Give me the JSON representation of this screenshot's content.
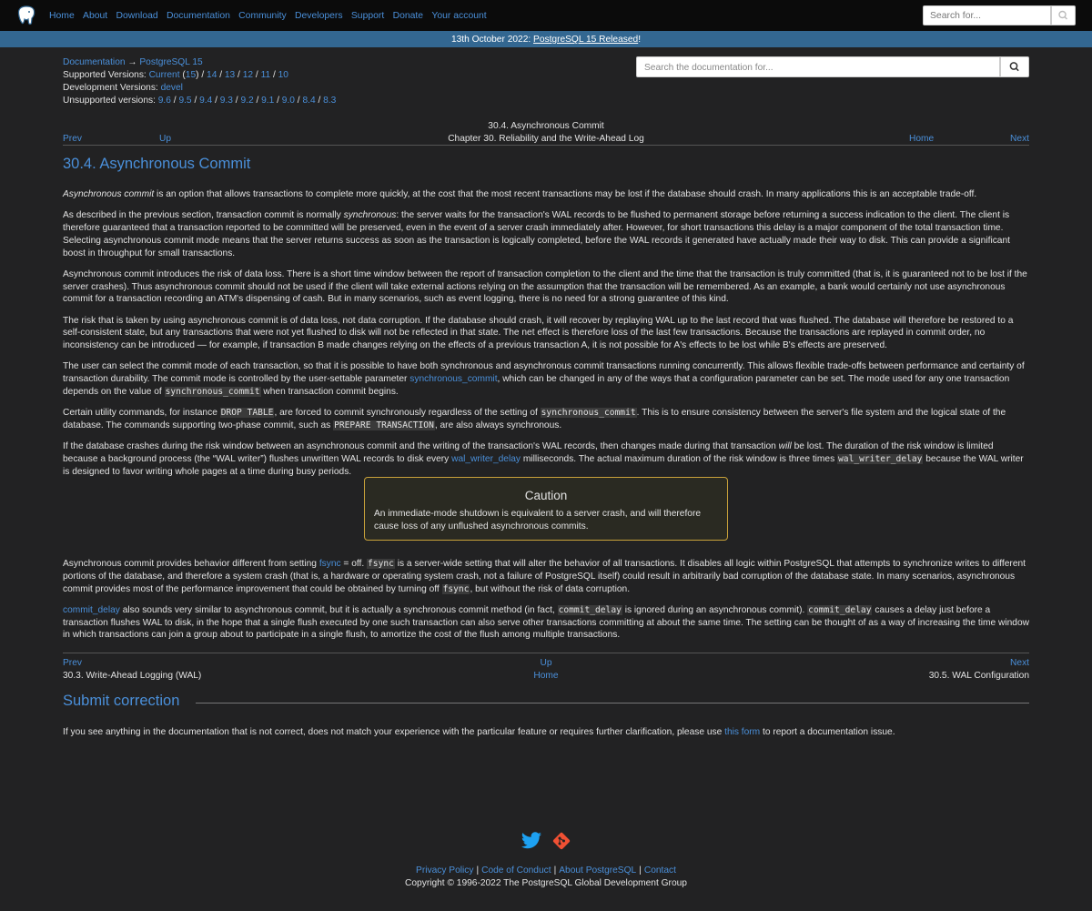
{
  "nav": {
    "items": [
      "Home",
      "About",
      "Download",
      "Documentation",
      "Community",
      "Developers",
      "Support",
      "Donate",
      "Your account"
    ],
    "search_placeholder": "Search for..."
  },
  "banner": {
    "date": "13th October 2022: ",
    "link": "PostgreSQL 15 Released",
    "end": "!"
  },
  "breadcrumb": {
    "documentation": "Documentation",
    "arrow": " → ",
    "current": "PostgreSQL 15"
  },
  "versions": {
    "supported_label": "Supported Versions: ",
    "current": "Current",
    "current_num": "15",
    "supported": [
      "14",
      "13",
      "12",
      "11",
      "10"
    ],
    "dev_label": "Development Versions: ",
    "devel": "devel",
    "unsupported_label": "Unsupported versions: ",
    "unsupported": [
      "9.6",
      "9.5",
      "9.4",
      "9.3",
      "9.2",
      "9.1",
      "9.0",
      "8.4",
      "8.3"
    ]
  },
  "doc_search_placeholder": "Search the documentation for...",
  "header": {
    "title": "30.4. Asynchronous Commit",
    "chapter": "Chapter 30. Reliability and the Write-Ahead Log",
    "prev": "Prev",
    "up": "Up",
    "home": "Home",
    "next": "Next"
  },
  "section_title": "30.4. Asynchronous Commit",
  "paragraphs": {
    "p1_em": "Asynchronous commit",
    "p1": " is an option that allows transactions to complete more quickly, at the cost that the most recent transactions may be lost if the database should crash. In many applications this is an acceptable trade-off.",
    "p2_a": "As described in the previous section, transaction commit is normally ",
    "p2_em": "synchronous",
    "p2_b": ": the server waits for the transaction's WAL records to be flushed to permanent storage before returning a success indication to the client. The client is therefore guaranteed that a transaction reported to be committed will be preserved, even in the event of a server crash immediately after. However, for short transactions this delay is a major component of the total transaction time. Selecting asynchronous commit mode means that the server returns success as soon as the transaction is logically completed, before the WAL records it generated have actually made their way to disk. This can provide a significant boost in throughput for small transactions.",
    "p3": "Asynchronous commit introduces the risk of data loss. There is a short time window between the report of transaction completion to the client and the time that the transaction is truly committed (that is, it is guaranteed not to be lost if the server crashes). Thus asynchronous commit should not be used if the client will take external actions relying on the assumption that the transaction will be remembered. As an example, a bank would certainly not use asynchronous commit for a transaction recording an ATM's dispensing of cash. But in many scenarios, such as event logging, there is no need for a strong guarantee of this kind.",
    "p4": "The risk that is taken by using asynchronous commit is of data loss, not data corruption. If the database should crash, it will recover by replaying WAL up to the last record that was flushed. The database will therefore be restored to a self-consistent state, but any transactions that were not yet flushed to disk will not be reflected in that state. The net effect is therefore loss of the last few transactions. Because the transactions are replayed in commit order, no inconsistency can be introduced — for example, if transaction B made changes relying on the effects of a previous transaction A, it is not possible for A's effects to be lost while B's effects are preserved.",
    "p5_a": "The user can select the commit mode of each transaction, so that it is possible to have both synchronous and asynchronous commit transactions running concurrently. This allows flexible trade-offs between performance and certainty of transaction durability. The commit mode is controlled by the user-settable parameter ",
    "p5_link": "synchronous_commit",
    "p5_b": ", which can be changed in any of the ways that a configuration parameter can be set. The mode used for any one transaction depends on the value of ",
    "p5_code": "synchronous_commit",
    "p5_c": " when transaction commit begins.",
    "p6_a": "Certain utility commands, for instance ",
    "p6_code1": "DROP TABLE",
    "p6_b": ", are forced to commit synchronously regardless of the setting of ",
    "p6_code2": "synchronous_commit",
    "p6_c": ". This is to ensure consistency between the server's file system and the logical state of the database. The commands supporting two-phase commit, such as ",
    "p6_code3": "PREPARE TRANSACTION",
    "p6_d": ", are also always synchronous.",
    "p7_a": "If the database crashes during the risk window between an asynchronous commit and the writing of the transaction's WAL records, then changes made during that transaction ",
    "p7_em": "will",
    "p7_b": " be lost. The duration of the risk window is limited because a background process (the “WAL writer”) flushes unwritten WAL records to disk every ",
    "p7_link": "wal_writer_delay",
    "p7_c": " milliseconds. The actual maximum duration of the risk window is three times ",
    "p7_code": "wal_writer_delay",
    "p7_d": " because the WAL writer is designed to favor writing whole pages at a time during busy periods.",
    "caution_title": "Caution",
    "caution_text": "An immediate-mode shutdown is equivalent to a server crash, and will therefore cause loss of any unflushed asynchronous commits.",
    "p8_a": "Asynchronous commit provides behavior different from setting ",
    "p8_link": "fsync",
    "p8_b": " = off. ",
    "p8_code1": "fsync",
    "p8_c": " is a server-wide setting that will alter the behavior of all transactions. It disables all logic within PostgreSQL that attempts to synchronize writes to different portions of the database, and therefore a system crash (that is, a hardware or operating system crash, not a failure of PostgreSQL itself) could result in arbitrarily bad corruption of the database state. In many scenarios, asynchronous commit provides most of the performance improvement that could be obtained by turning off ",
    "p8_code2": "fsync",
    "p8_d": ", but without the risk of data corruption.",
    "p9_link": "commit_delay",
    "p9_a": " also sounds very similar to asynchronous commit, but it is actually a synchronous commit method (in fact, ",
    "p9_code1": "commit_delay",
    "p9_b": " is ignored during an asynchronous commit). ",
    "p9_code2": "commit_delay",
    "p9_c": " causes a delay just before a transaction flushes WAL to disk, in the hope that a single flush executed by one such transaction can also serve other transactions committing at about the same time. The setting can be thought of as a way of increasing the time window in which transactions can join a group about to participate in a single flush, to amortize the cost of the flush among multiple transactions."
  },
  "footer_nav": {
    "prev": "Prev",
    "up": "Up",
    "next": "Next",
    "prev_title": "30.3. Write-Ahead Logging (WAL)",
    "home": "Home",
    "next_title": "30.5. WAL Configuration"
  },
  "submit": {
    "title": "Submit correction",
    "text_a": "If you see anything in the documentation that is not correct, does not match your experience with the particular feature or requires further clarification, please use ",
    "link": "this form",
    "text_b": " to report a documentation issue."
  },
  "footer": {
    "links": [
      "Privacy Policy",
      "Code of Conduct",
      "About PostgreSQL",
      "Contact"
    ],
    "copyright": "Copyright © 1996-2022 The PostgreSQL Global Development Group"
  },
  "colors": {
    "background": "#222223",
    "link": "#4a8fd9",
    "banner": "#336791",
    "caution_border": "#c8a13a"
  }
}
